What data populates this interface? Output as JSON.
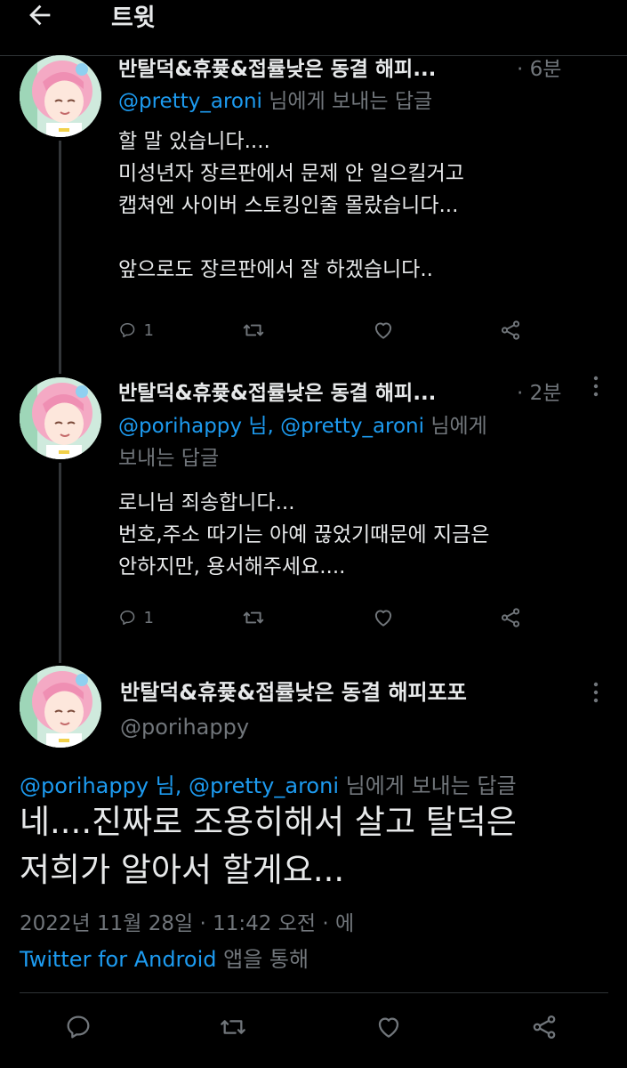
{
  "header": {
    "title": "트윗"
  },
  "tweets": [
    {
      "display_name": "반탈덕&휴퓿&접률낮은 동결 해피...",
      "time": "· 6분",
      "replying_mentions": "@pretty_aroni",
      "replying_suffix": "님에게 보내는 답글",
      "text": "할 말 있습니다....\n미성년자 장르판에서 문제 안 일으킬거고\n캡쳐엔 사이버 스토킹인줄 몰랐습니다...\n\n앞으로도 장르판에서 잘 하겠습니다..",
      "reply_count": "1"
    },
    {
      "display_name": "반탈덕&휴퓿&접률낮은 동결 해피...",
      "time": "· 2분",
      "replying_mentions": "@porihappy 님, @pretty_aroni",
      "replying_suffix_line1": "님에게",
      "replying_suffix_line2": "보내는 답글",
      "text": "로니님 죄송합니다...\n번호,주소 따기는 아예 끊었기때문에 지금은\n안하지만, 용서해주세요....",
      "reply_count": "1"
    }
  ],
  "main_tweet": {
    "display_name": "반탈덕&휴퓿&접률낮은 동결 해피포포",
    "handle": "@porihappy",
    "replying_mentions": "@porihappy 님, @pretty_aroni",
    "replying_suffix": "님에게 보내는 답글",
    "text": "네....진짜로 조용히해서 살고 탈덕은\n저희가 알아서 할게요...",
    "timestamp": "2022년 11월 28일 · 11:42 오전 · 에",
    "source_app": "Twitter for Android",
    "source_suffix": "앱을 통해"
  },
  "icons": {
    "back": "arrow-left-icon",
    "more": "more-dots-icon",
    "reply": "reply-icon",
    "retweet": "retweet-icon",
    "like": "heart-icon",
    "share": "share-icon"
  },
  "colors": {
    "accent": "#1d9bf0",
    "muted": "#71767b",
    "text": "#e7e9ea",
    "background": "#000000"
  }
}
